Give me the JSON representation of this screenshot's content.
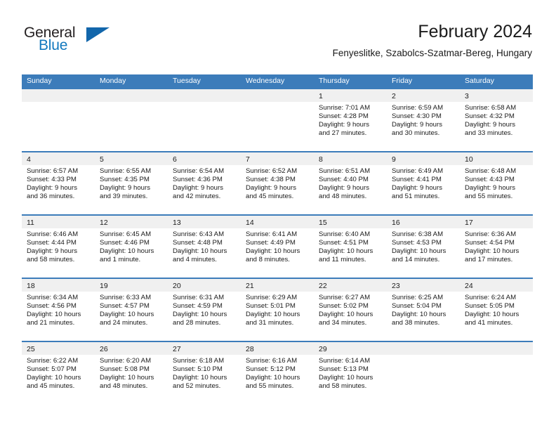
{
  "brand": {
    "name_part1": "General",
    "name_part2": "Blue",
    "accent_color": "#1266ab",
    "text_color": "#231f20"
  },
  "header": {
    "title": "February 2024",
    "subtitle": "Fenyeslitke, Szabolcs-Szatmar-Bereg, Hungary"
  },
  "theme": {
    "header_bar_color": "#3c7cba",
    "daynum_band_color": "#f0f0f0",
    "text_color": "#1a1a1a"
  },
  "weekdays": [
    "Sunday",
    "Monday",
    "Tuesday",
    "Wednesday",
    "Thursday",
    "Friday",
    "Saturday"
  ],
  "weeks": [
    [
      {
        "day": "",
        "sunrise": "",
        "sunset": "",
        "daylight_line1": "",
        "daylight_line2": ""
      },
      {
        "day": "",
        "sunrise": "",
        "sunset": "",
        "daylight_line1": "",
        "daylight_line2": ""
      },
      {
        "day": "",
        "sunrise": "",
        "sunset": "",
        "daylight_line1": "",
        "daylight_line2": ""
      },
      {
        "day": "",
        "sunrise": "",
        "sunset": "",
        "daylight_line1": "",
        "daylight_line2": ""
      },
      {
        "day": "1",
        "sunrise": "Sunrise: 7:01 AM",
        "sunset": "Sunset: 4:28 PM",
        "daylight_line1": "Daylight: 9 hours",
        "daylight_line2": "and 27 minutes."
      },
      {
        "day": "2",
        "sunrise": "Sunrise: 6:59 AM",
        "sunset": "Sunset: 4:30 PM",
        "daylight_line1": "Daylight: 9 hours",
        "daylight_line2": "and 30 minutes."
      },
      {
        "day": "3",
        "sunrise": "Sunrise: 6:58 AM",
        "sunset": "Sunset: 4:32 PM",
        "daylight_line1": "Daylight: 9 hours",
        "daylight_line2": "and 33 minutes."
      }
    ],
    [
      {
        "day": "4",
        "sunrise": "Sunrise: 6:57 AM",
        "sunset": "Sunset: 4:33 PM",
        "daylight_line1": "Daylight: 9 hours",
        "daylight_line2": "and 36 minutes."
      },
      {
        "day": "5",
        "sunrise": "Sunrise: 6:55 AM",
        "sunset": "Sunset: 4:35 PM",
        "daylight_line1": "Daylight: 9 hours",
        "daylight_line2": "and 39 minutes."
      },
      {
        "day": "6",
        "sunrise": "Sunrise: 6:54 AM",
        "sunset": "Sunset: 4:36 PM",
        "daylight_line1": "Daylight: 9 hours",
        "daylight_line2": "and 42 minutes."
      },
      {
        "day": "7",
        "sunrise": "Sunrise: 6:52 AM",
        "sunset": "Sunset: 4:38 PM",
        "daylight_line1": "Daylight: 9 hours",
        "daylight_line2": "and 45 minutes."
      },
      {
        "day": "8",
        "sunrise": "Sunrise: 6:51 AM",
        "sunset": "Sunset: 4:40 PM",
        "daylight_line1": "Daylight: 9 hours",
        "daylight_line2": "and 48 minutes."
      },
      {
        "day": "9",
        "sunrise": "Sunrise: 6:49 AM",
        "sunset": "Sunset: 4:41 PM",
        "daylight_line1": "Daylight: 9 hours",
        "daylight_line2": "and 51 minutes."
      },
      {
        "day": "10",
        "sunrise": "Sunrise: 6:48 AM",
        "sunset": "Sunset: 4:43 PM",
        "daylight_line1": "Daylight: 9 hours",
        "daylight_line2": "and 55 minutes."
      }
    ],
    [
      {
        "day": "11",
        "sunrise": "Sunrise: 6:46 AM",
        "sunset": "Sunset: 4:44 PM",
        "daylight_line1": "Daylight: 9 hours",
        "daylight_line2": "and 58 minutes."
      },
      {
        "day": "12",
        "sunrise": "Sunrise: 6:45 AM",
        "sunset": "Sunset: 4:46 PM",
        "daylight_line1": "Daylight: 10 hours",
        "daylight_line2": "and 1 minute."
      },
      {
        "day": "13",
        "sunrise": "Sunrise: 6:43 AM",
        "sunset": "Sunset: 4:48 PM",
        "daylight_line1": "Daylight: 10 hours",
        "daylight_line2": "and 4 minutes."
      },
      {
        "day": "14",
        "sunrise": "Sunrise: 6:41 AM",
        "sunset": "Sunset: 4:49 PM",
        "daylight_line1": "Daylight: 10 hours",
        "daylight_line2": "and 8 minutes."
      },
      {
        "day": "15",
        "sunrise": "Sunrise: 6:40 AM",
        "sunset": "Sunset: 4:51 PM",
        "daylight_line1": "Daylight: 10 hours",
        "daylight_line2": "and 11 minutes."
      },
      {
        "day": "16",
        "sunrise": "Sunrise: 6:38 AM",
        "sunset": "Sunset: 4:53 PM",
        "daylight_line1": "Daylight: 10 hours",
        "daylight_line2": "and 14 minutes."
      },
      {
        "day": "17",
        "sunrise": "Sunrise: 6:36 AM",
        "sunset": "Sunset: 4:54 PM",
        "daylight_line1": "Daylight: 10 hours",
        "daylight_line2": "and 17 minutes."
      }
    ],
    [
      {
        "day": "18",
        "sunrise": "Sunrise: 6:34 AM",
        "sunset": "Sunset: 4:56 PM",
        "daylight_line1": "Daylight: 10 hours",
        "daylight_line2": "and 21 minutes."
      },
      {
        "day": "19",
        "sunrise": "Sunrise: 6:33 AM",
        "sunset": "Sunset: 4:57 PM",
        "daylight_line1": "Daylight: 10 hours",
        "daylight_line2": "and 24 minutes."
      },
      {
        "day": "20",
        "sunrise": "Sunrise: 6:31 AM",
        "sunset": "Sunset: 4:59 PM",
        "daylight_line1": "Daylight: 10 hours",
        "daylight_line2": "and 28 minutes."
      },
      {
        "day": "21",
        "sunrise": "Sunrise: 6:29 AM",
        "sunset": "Sunset: 5:01 PM",
        "daylight_line1": "Daylight: 10 hours",
        "daylight_line2": "and 31 minutes."
      },
      {
        "day": "22",
        "sunrise": "Sunrise: 6:27 AM",
        "sunset": "Sunset: 5:02 PM",
        "daylight_line1": "Daylight: 10 hours",
        "daylight_line2": "and 34 minutes."
      },
      {
        "day": "23",
        "sunrise": "Sunrise: 6:25 AM",
        "sunset": "Sunset: 5:04 PM",
        "daylight_line1": "Daylight: 10 hours",
        "daylight_line2": "and 38 minutes."
      },
      {
        "day": "24",
        "sunrise": "Sunrise: 6:24 AM",
        "sunset": "Sunset: 5:05 PM",
        "daylight_line1": "Daylight: 10 hours",
        "daylight_line2": "and 41 minutes."
      }
    ],
    [
      {
        "day": "25",
        "sunrise": "Sunrise: 6:22 AM",
        "sunset": "Sunset: 5:07 PM",
        "daylight_line1": "Daylight: 10 hours",
        "daylight_line2": "and 45 minutes."
      },
      {
        "day": "26",
        "sunrise": "Sunrise: 6:20 AM",
        "sunset": "Sunset: 5:08 PM",
        "daylight_line1": "Daylight: 10 hours",
        "daylight_line2": "and 48 minutes."
      },
      {
        "day": "27",
        "sunrise": "Sunrise: 6:18 AM",
        "sunset": "Sunset: 5:10 PM",
        "daylight_line1": "Daylight: 10 hours",
        "daylight_line2": "and 52 minutes."
      },
      {
        "day": "28",
        "sunrise": "Sunrise: 6:16 AM",
        "sunset": "Sunset: 5:12 PM",
        "daylight_line1": "Daylight: 10 hours",
        "daylight_line2": "and 55 minutes."
      },
      {
        "day": "29",
        "sunrise": "Sunrise: 6:14 AM",
        "sunset": "Sunset: 5:13 PM",
        "daylight_line1": "Daylight: 10 hours",
        "daylight_line2": "and 58 minutes."
      },
      {
        "day": "",
        "sunrise": "",
        "sunset": "",
        "daylight_line1": "",
        "daylight_line2": ""
      },
      {
        "day": "",
        "sunrise": "",
        "sunset": "",
        "daylight_line1": "",
        "daylight_line2": ""
      }
    ]
  ]
}
